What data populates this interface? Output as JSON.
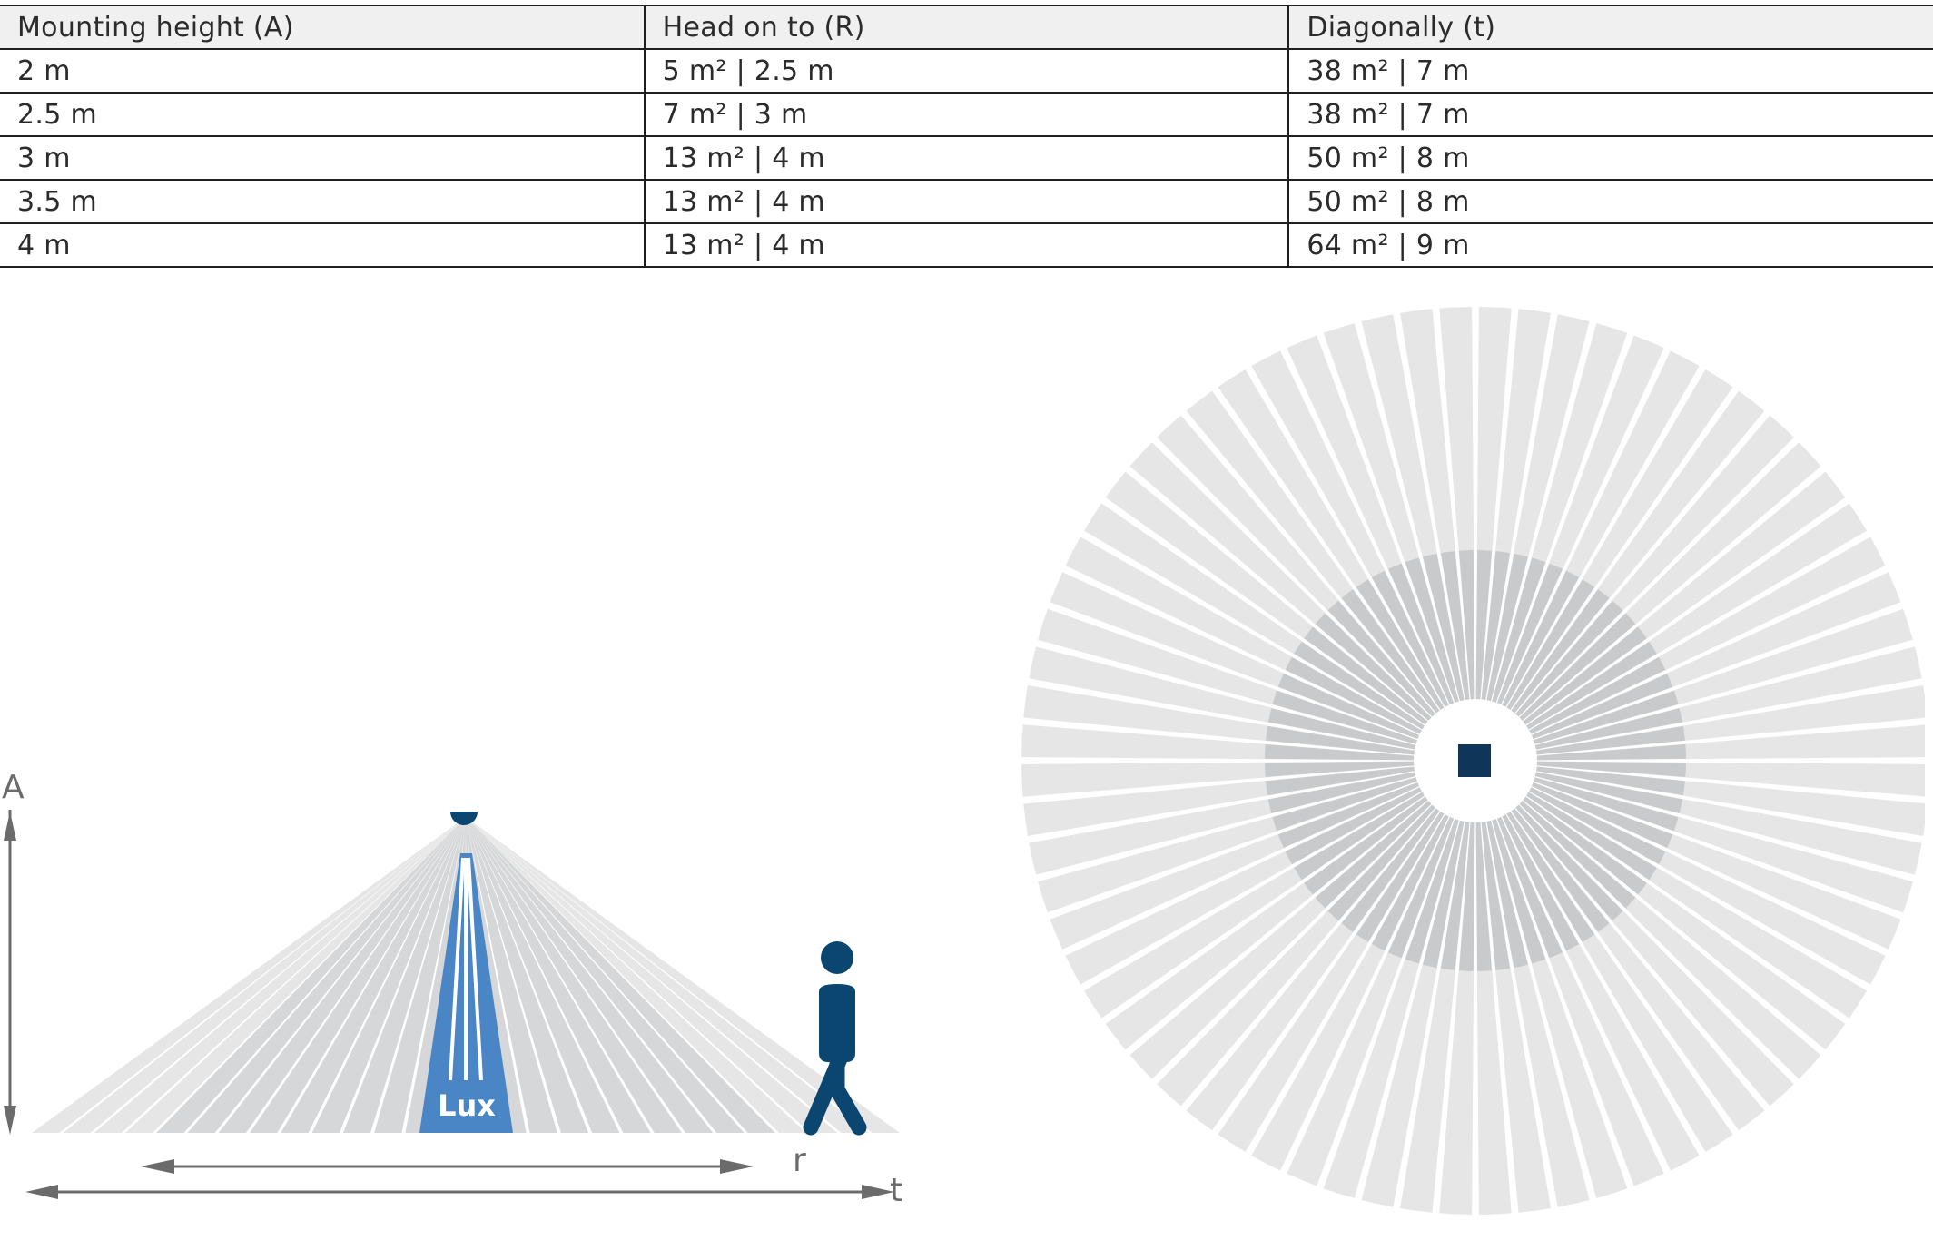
{
  "table": {
    "headers": [
      "Mounting height (A)",
      "Head on to (R)",
      "Diagonally (t)"
    ],
    "rows": [
      [
        "2 m",
        "5 m² | 2.5 m",
        "38 m² | 7 m"
      ],
      [
        "2.5 m",
        "7 m² | 3 m",
        "38 m² | 7 m"
      ],
      [
        "3 m",
        "13 m² | 4 m",
        "50 m² | 8 m"
      ],
      [
        "3.5 m",
        "13 m² | 4 m",
        "50 m² | 8 m"
      ],
      [
        "4 m",
        "13 m² | 4 m",
        "64 m² | 9 m"
      ]
    ]
  },
  "side_view": {
    "label_height": "A",
    "label_head_on": "r",
    "label_diagonal": "t",
    "lux_label": "Lux"
  },
  "colors": {
    "zone_light": "#e6e6e6",
    "zone_mid": "#d6d7d8",
    "zone_inner": "#c9cacb",
    "lux_blue": "#4a86c5",
    "sensor_navy": "#0b4670",
    "person_navy": "#0b4670",
    "center_square": "#0f3558",
    "arrow_gray": "#6b6b6b"
  }
}
